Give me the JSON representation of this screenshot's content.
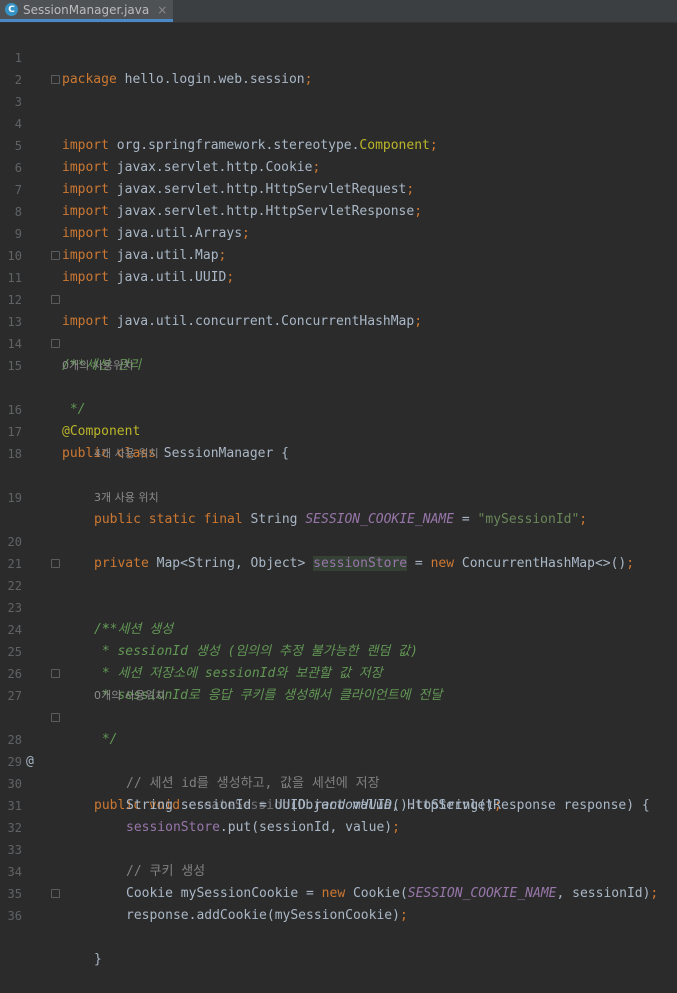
{
  "tab": {
    "icon_letter": "C",
    "title": "SessionManager.java",
    "close": "×"
  },
  "gutter": {
    "override_marker": "@"
  },
  "hints": {
    "h1": "0개의 사용위치",
    "h2": "4개 사용 위치",
    "h3": "3개 사용 위치",
    "h4": "0개의 사용위치"
  },
  "code": {
    "l1_kw": "package",
    "l1_rest": " hello.login.web.session",
    "semi": ";",
    "import": "import",
    "l3_pkg": " org.springframework.stereotype.",
    "l3_cls": "Component",
    "l5": " javax.servlet.http.Cookie",
    "l6": " javax.servlet.http.HttpServletRequest",
    "l7": " javax.servlet.http.HttpServletResponse",
    "l8": " java.util.Arrays",
    "l9": " java.util.Map",
    "l10": " java.util.UUID",
    "l11": " java.util.concurrent.ConcurrentHashMap",
    "l13": "/**",
    "l14": " * 세션 관리",
    "l15": " */",
    "l16": "@Component",
    "l17_kw": "public class",
    "l17_rest": " SessionManager {",
    "l19_kw": "public static final",
    "l19_type": " String ",
    "l19_field": "SESSION_COOKIE_NAME",
    "l19_eq": " = ",
    "l19_str": "\"mySessionId\"",
    "l20_kw": "private",
    "l20_type": " Map<String, Object> ",
    "l20_field": "sessionStore",
    "l20_eq": " = ",
    "l20_new": "new",
    "l20_rest": " ConcurrentHashMap<>()",
    "l22": "/**",
    "l23": " * 세션 생성",
    "l24": " * sessionId 생성 (임의의 추정 불가능한 랜덤 값)",
    "l25": " * 세션 저장소에 sessionId와 보관할 값 저장",
    "l26": " * sessionId로 응답 쿠키를 생성해서 클라이언트에 전달",
    "l27": " */",
    "l28_kw": "public void",
    "l28_name": " createSession",
    "l28_rest": "(Object value, HttpServletResponse response) {",
    "l29": "// 세션 id를 생성하고, 값을 세션에 저장",
    "l30_a": "String sessionId = UUID.",
    "l30_m": "randomUUID",
    "l30_b": "().toString()",
    "l31_f": "sessionStore",
    "l31_rest": ".put(sessionId, value)",
    "l33": "// 쿠키 생성",
    "l34_a": "Cookie mySessionCookie = ",
    "l34_new": "new",
    "l34_b": " Cookie(",
    "l34_f": "SESSION_COOKIE_NAME",
    "l34_c": ", sessionId)",
    "l35": "response.addCookie(mySessionCookie)",
    "l36": "}"
  },
  "line_numbers": [
    "1",
    "2",
    "3",
    "4",
    "5",
    "6",
    "7",
    "8",
    "9",
    "10",
    "11",
    "12",
    "13",
    "14",
    "15",
    "16",
    "17",
    "18",
    "19",
    "20",
    "21",
    "22",
    "23",
    "24",
    "25",
    "26",
    "27",
    "28",
    "29",
    "30",
    "31",
    "32",
    "33",
    "34",
    "35",
    "36"
  ],
  "colors": {
    "background": "#2b2b2b",
    "keyword": "#cc7832",
    "string": "#6a8759",
    "doc_comment": "#629755",
    "annotation": "#bbb529",
    "field": "#9876aa",
    "line_number": "#606366"
  }
}
